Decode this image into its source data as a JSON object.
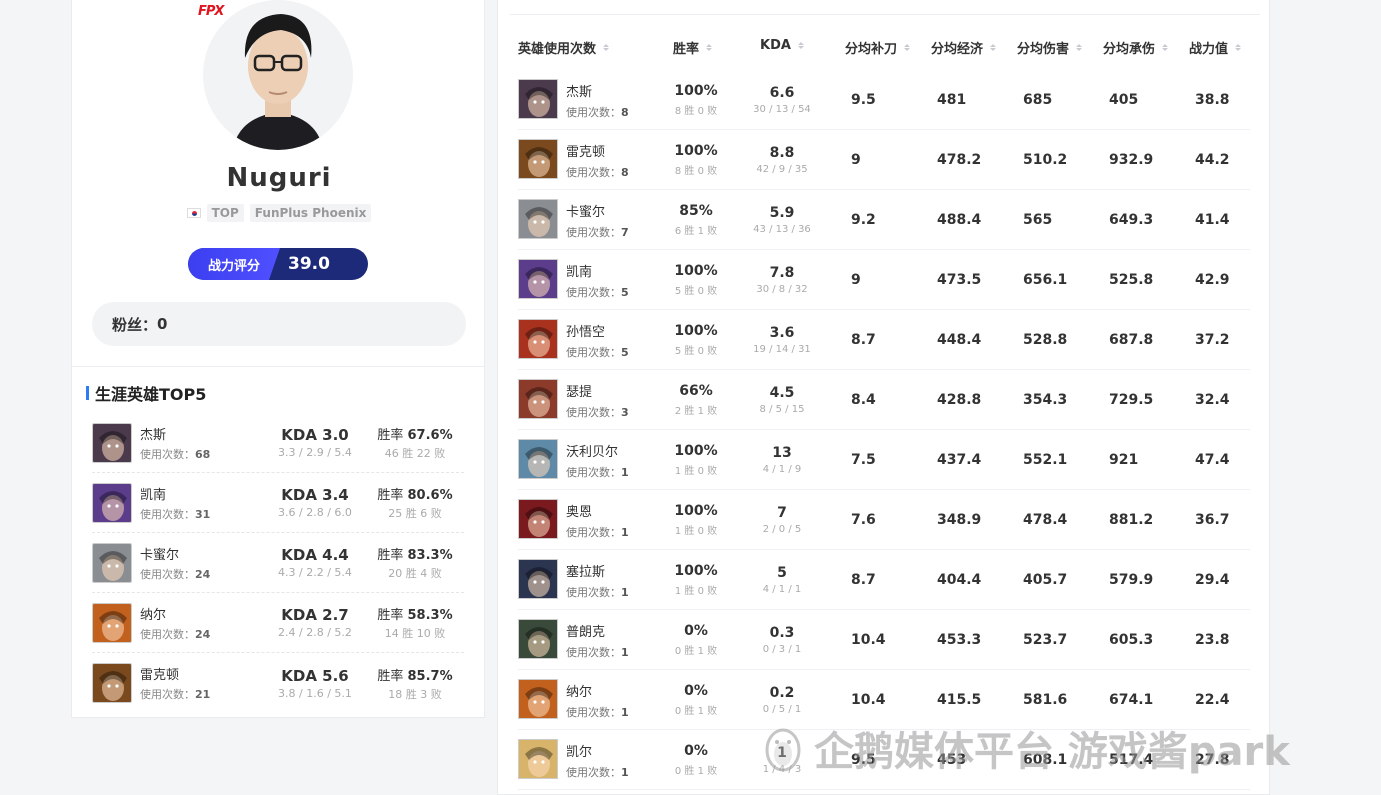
{
  "player": {
    "team_logo": "FPX",
    "name": "Nuguri",
    "country_flag": "korea-flag-icon",
    "role": "TOP",
    "team": "FunPlus Phoenix",
    "power_label": "战力评分",
    "power_value": "39.0",
    "fans_label": "粉丝：",
    "fans_value": "0"
  },
  "career": {
    "title": "生涯英雄TOP5",
    "heroes": [
      {
        "name": "杰斯",
        "uses_label": "使用次数：",
        "uses": "68",
        "kda": "KDA 3.0",
        "kda_detail": "3.3 / 2.9 / 5.4",
        "wr_label": "胜率",
        "wr": "67.6%",
        "record": "46 胜 22 败",
        "icon": "jayce-icon",
        "color": "#4a3a4c"
      },
      {
        "name": "凯南",
        "uses_label": "使用次数：",
        "uses": "31",
        "kda": "KDA 3.4",
        "kda_detail": "3.6 / 2.8 / 6.0",
        "wr_label": "胜率",
        "wr": "80.6%",
        "record": "25 胜 6 败",
        "icon": "kennen-icon",
        "color": "#5b3d8c"
      },
      {
        "name": "卡蜜尔",
        "uses_label": "使用次数：",
        "uses": "24",
        "kda": "KDA 4.4",
        "kda_detail": "4.3 / 2.2 / 5.4",
        "wr_label": "胜率",
        "wr": "83.3%",
        "record": "20 胜 4 败",
        "icon": "camille-icon",
        "color": "#8a8d92"
      },
      {
        "name": "纳尔",
        "uses_label": "使用次数：",
        "uses": "24",
        "kda": "KDA 2.7",
        "kda_detail": "2.4 / 2.8 / 5.2",
        "wr_label": "胜率",
        "wr": "58.3%",
        "record": "14 胜 10 败",
        "icon": "gnar-icon",
        "color": "#c2601e"
      },
      {
        "name": "雷克顿",
        "uses_label": "使用次数：",
        "uses": "21",
        "kda": "KDA 5.6",
        "kda_detail": "3.8 / 1.6 / 5.1",
        "wr_label": "胜率",
        "wr": "85.7%",
        "record": "18 胜 3 败",
        "icon": "renekton-icon",
        "color": "#7a4a1e"
      }
    ]
  },
  "table": {
    "headers": [
      "英雄使用次数",
      "胜率",
      "KDA",
      "分均补刀",
      "分均经济",
      "分均伤害",
      "分均承伤",
      "战力值"
    ],
    "uses_label": "使用次数：",
    "rows": [
      {
        "name": "杰斯",
        "uses": "8",
        "wr": "100%",
        "record": "8 胜 0 败",
        "kda": "6.6",
        "kda_detail": "30 / 13 / 54",
        "cs": "9.5",
        "gold": "481",
        "dmg": "685",
        "taken": "405",
        "power": "38.8",
        "icon": "jayce-icon",
        "color": "#4a3a4c"
      },
      {
        "name": "雷克顿",
        "uses": "8",
        "wr": "100%",
        "record": "8 胜 0 败",
        "kda": "8.8",
        "kda_detail": "42 / 9 / 35",
        "cs": "9",
        "gold": "478.2",
        "dmg": "510.2",
        "taken": "932.9",
        "power": "44.2",
        "icon": "renekton-icon",
        "color": "#7a4a1e"
      },
      {
        "name": "卡蜜尔",
        "uses": "7",
        "wr": "85%",
        "record": "6 胜 1 败",
        "kda": "5.9",
        "kda_detail": "43 / 13 / 36",
        "cs": "9.2",
        "gold": "488.4",
        "dmg": "565",
        "taken": "649.3",
        "power": "41.4",
        "icon": "camille-icon",
        "color": "#8a8d92"
      },
      {
        "name": "凯南",
        "uses": "5",
        "wr": "100%",
        "record": "5 胜 0 败",
        "kda": "7.8",
        "kda_detail": "30 / 8 / 32",
        "cs": "9",
        "gold": "473.5",
        "dmg": "656.1",
        "taken": "525.8",
        "power": "42.9",
        "icon": "kennen-icon",
        "color": "#5b3d8c"
      },
      {
        "name": "孙悟空",
        "uses": "5",
        "wr": "100%",
        "record": "5 胜 0 败",
        "kda": "3.6",
        "kda_detail": "19 / 14 / 31",
        "cs": "8.7",
        "gold": "448.4",
        "dmg": "528.8",
        "taken": "687.8",
        "power": "37.2",
        "icon": "wukong-icon",
        "color": "#a8321e"
      },
      {
        "name": "瑟提",
        "uses": "3",
        "wr": "66%",
        "record": "2 胜 1 败",
        "kda": "4.5",
        "kda_detail": "8 / 5 / 15",
        "cs": "8.4",
        "gold": "428.8",
        "dmg": "354.3",
        "taken": "729.5",
        "power": "32.4",
        "icon": "sett-icon",
        "color": "#8c3a2a"
      },
      {
        "name": "沃利贝尔",
        "uses": "1",
        "wr": "100%",
        "record": "1 胜 0 败",
        "kda": "13",
        "kda_detail": "4 / 1 / 9",
        "cs": "7.5",
        "gold": "437.4",
        "dmg": "552.1",
        "taken": "921",
        "power": "47.4",
        "icon": "volibear-icon",
        "color": "#5e8aa8"
      },
      {
        "name": "奥恩",
        "uses": "1",
        "wr": "100%",
        "record": "1 胜 0 败",
        "kda": "7",
        "kda_detail": "2 / 0 / 5",
        "cs": "7.6",
        "gold": "348.9",
        "dmg": "478.4",
        "taken": "881.2",
        "power": "36.7",
        "icon": "ornn-icon",
        "color": "#7a1a1e"
      },
      {
        "name": "塞拉斯",
        "uses": "1",
        "wr": "100%",
        "record": "1 胜 0 败",
        "kda": "5",
        "kda_detail": "4 / 1 / 1",
        "cs": "8.7",
        "gold": "404.4",
        "dmg": "405.7",
        "taken": "579.9",
        "power": "29.4",
        "icon": "sylas-icon",
        "color": "#2c3550"
      },
      {
        "name": "普朗克",
        "uses": "1",
        "wr": "0%",
        "record": "0 胜 1 败",
        "kda": "0.3",
        "kda_detail": "0 / 3 / 1",
        "cs": "10.4",
        "gold": "453.3",
        "dmg": "523.7",
        "taken": "605.3",
        "power": "23.8",
        "icon": "gangplank-icon",
        "color": "#3a4a3a"
      },
      {
        "name": "纳尔",
        "uses": "1",
        "wr": "0%",
        "record": "0 胜 1 败",
        "kda": "0.2",
        "kda_detail": "0 / 5 / 1",
        "cs": "10.4",
        "gold": "415.5",
        "dmg": "581.6",
        "taken": "674.1",
        "power": "22.4",
        "icon": "gnar-icon",
        "color": "#c2601e"
      },
      {
        "name": "凯尔",
        "uses": "1",
        "wr": "0%",
        "record": "0 胜 1 败",
        "kda": "1",
        "kda_detail": "1 / 4 / 3",
        "cs": "9.5",
        "gold": "453",
        "dmg": "608.1",
        "taken": "517.4",
        "power": "27.8",
        "icon": "kayle-icon",
        "color": "#d8b46a"
      }
    ]
  },
  "watermark": {
    "text": "企鹅媒体平台 游戏酱park",
    "icon": "penguin-icon"
  }
}
